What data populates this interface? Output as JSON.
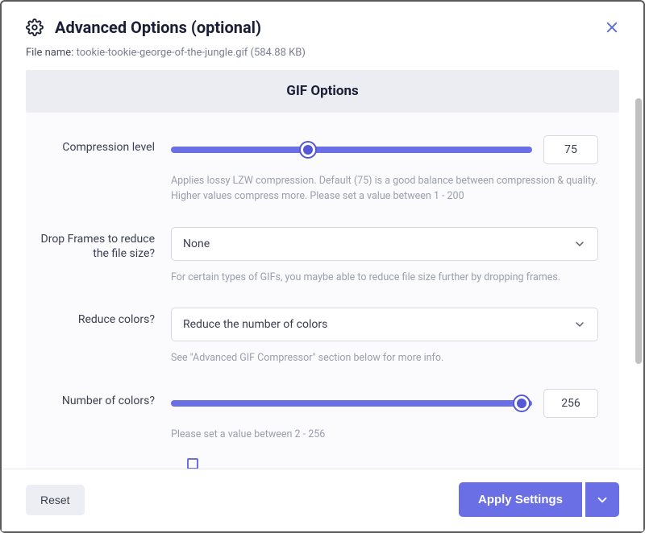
{
  "header": {
    "title": "Advanced Options (optional)"
  },
  "file": {
    "label": "File name:",
    "value": "tookie-tookie-george-of-the-jungle.gif (584.88 KB)"
  },
  "section": {
    "title": "GIF Options"
  },
  "compression": {
    "label": "Compression level",
    "value": "75",
    "helper": "Applies lossy LZW compression. Default (75) is a good balance between compression & quality. Higher values compress more. Please set a value between 1 - 200"
  },
  "dropFrames": {
    "label": "Drop Frames to reduce the file size?",
    "value": "None",
    "helper": "For certain types of GIFs, you maybe able to reduce file size further by dropping frames."
  },
  "reduceColors": {
    "label": "Reduce colors?",
    "value": "Reduce the number of colors",
    "helper": "See \"Advanced GIF Compressor\" section below for more info."
  },
  "numColors": {
    "label": "Number of colors?",
    "value": "256",
    "helper": "Please set a value between 2 - 256"
  },
  "footer": {
    "reset": "Reset",
    "apply": "Apply Settings"
  }
}
